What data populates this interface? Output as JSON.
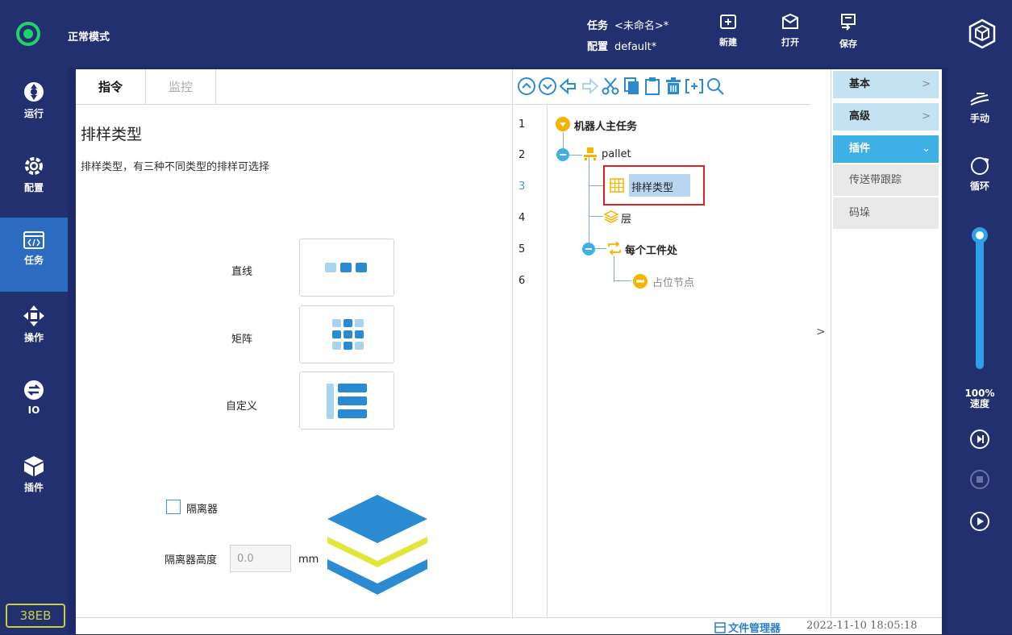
{
  "header": {
    "mode": "正常模式",
    "task_label": "任务",
    "task_value": "<未命名>*",
    "config_label": "配置",
    "config_value": "default*",
    "new_label": "新建",
    "open_label": "打开",
    "save_label": "保存"
  },
  "leftnav": {
    "items": [
      {
        "label": "运行",
        "icon": "run-icon"
      },
      {
        "label": "配置",
        "icon": "gear-icon"
      },
      {
        "label": "任务",
        "icon": "code-icon"
      },
      {
        "label": "操作",
        "icon": "move-icon"
      },
      {
        "label": "IO",
        "icon": "io-icon"
      },
      {
        "label": "插件",
        "icon": "cube-icon"
      }
    ],
    "active": "任务",
    "version": "38EB"
  },
  "left_panel": {
    "tabs": [
      "指令",
      "监控"
    ],
    "title": "排样类型",
    "description": "排样类型，有三种不同类型的排样可选择",
    "options": [
      "直线",
      "矩阵",
      "自定义"
    ],
    "separator_label": "隔离器",
    "separator_height_label": "隔离器高度",
    "separator_height_value": "0.0",
    "unit": "mm"
  },
  "tree": {
    "line_numbers": [
      "1",
      "2",
      "3",
      "4",
      "5",
      "6"
    ],
    "nodes": [
      {
        "text": "机器人主任务"
      },
      {
        "text": "pallet"
      },
      {
        "text": "排样类型"
      },
      {
        "text": "层"
      },
      {
        "text": "每个工件处"
      },
      {
        "text": "占位节点"
      }
    ],
    "expand_arrow": ">"
  },
  "library": {
    "sections": [
      "基本",
      "高级",
      "插件"
    ],
    "plugin_items": [
      "传送带跟踪",
      "码垛"
    ],
    "chevron": ">",
    "chevron_open": "⌄"
  },
  "status": {
    "file_manager": "文件管理器",
    "timestamp": "2022-11-10 18:05:18"
  },
  "rightnav": {
    "manual": "手动",
    "loop": "循环",
    "speed_pct": "100%",
    "speed_label": "速度",
    "speed_value": 1.0
  },
  "colors": {
    "nav_bg": "#23306f",
    "active_nav": "#2b6bc0",
    "accent": "#3fb0e5",
    "status_green": "#1fd36a",
    "highlight_red": "#e02020",
    "tree_orange": "#f5b400"
  }
}
